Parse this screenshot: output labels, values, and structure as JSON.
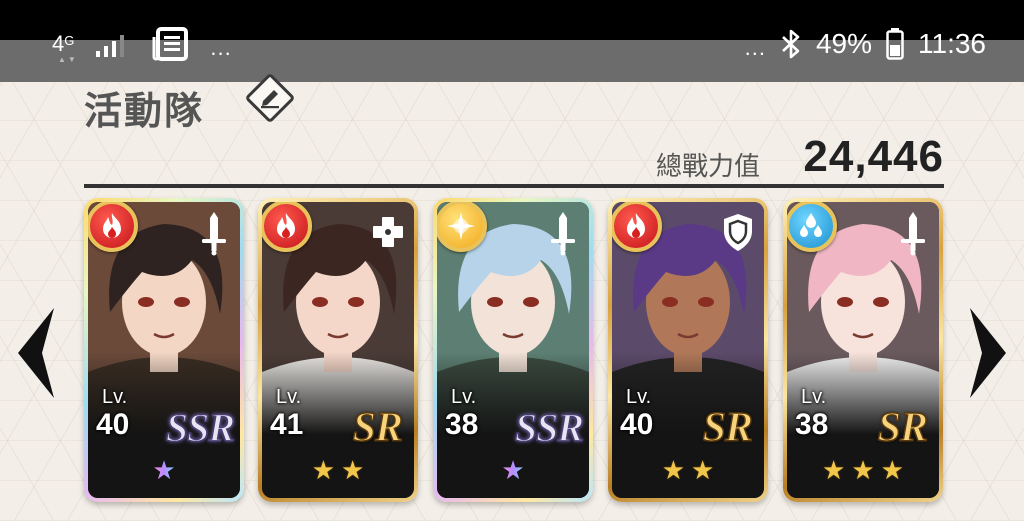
{
  "status_bar": {
    "network": "4",
    "network_sup": "G",
    "overflow_left": "...",
    "overflow_right": "...",
    "battery": "49%",
    "time": "11:36"
  },
  "header": {
    "title": "活動隊",
    "power_label": "總戰力值",
    "power_value": "24,446"
  },
  "cards": [
    {
      "element": "fire",
      "role": "sword",
      "lv_label": "Lv.",
      "level": "40",
      "rarity": "SSR",
      "frame": "rainbow",
      "stars": 1,
      "star_type": "rainbow",
      "palette": {
        "hair": "#2e2320",
        "skin": "#f3d6c4",
        "bg": "#6b4a3a",
        "cloth": "#3a2d22"
      }
    },
    {
      "element": "fire",
      "role": "heal",
      "lv_label": "Lv.",
      "level": "41",
      "rarity": "SR",
      "frame": "gold",
      "stars": 2,
      "star_type": "gold",
      "palette": {
        "hair": "#3b2622",
        "skin": "#f4d7c8",
        "bg": "#4a3b36",
        "cloth": "#e9e6e2"
      }
    },
    {
      "element": "light",
      "role": "sword",
      "lv_label": "Lv.",
      "level": "38",
      "rarity": "SSR",
      "frame": "rainbow",
      "stars": 1,
      "star_type": "rainbow",
      "palette": {
        "hair": "#b6d3ea",
        "skin": "#f2e2d7",
        "bg": "#5d7f73",
        "cloth": "#3a4a3f"
      }
    },
    {
      "element": "fire",
      "role": "shield",
      "lv_label": "Lv.",
      "level": "40",
      "rarity": "SR",
      "frame": "gold",
      "stars": 2,
      "star_type": "gold",
      "palette": {
        "hair": "#5a3a86",
        "skin": "#b07858",
        "bg": "#5b4a6a",
        "cloth": "#222222"
      }
    },
    {
      "element": "water",
      "role": "sword",
      "lv_label": "Lv.",
      "level": "38",
      "rarity": "SR",
      "frame": "gold",
      "stars": 3,
      "star_type": "gold",
      "palette": {
        "hair": "#f0b6c4",
        "skin": "#f7e3dc",
        "bg": "#6a5a5e",
        "cloth": "#efefef"
      }
    }
  ]
}
